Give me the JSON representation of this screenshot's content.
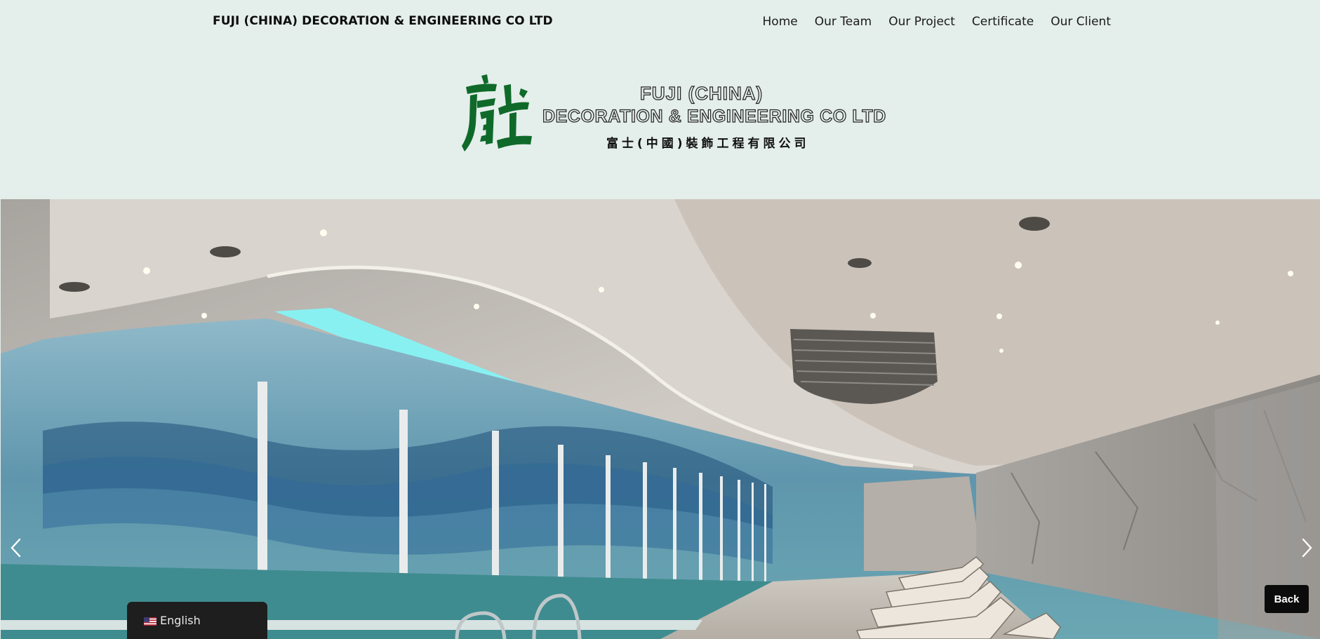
{
  "header": {
    "site_title": "FUJI (CHINA) DECORATION & ENGINEERING CO LTD",
    "nav": [
      "Home",
      "Our Team",
      "Our Project",
      "Certificate",
      "Our Client"
    ]
  },
  "logo": {
    "line1": "FUJI (CHINA)",
    "line2": "DECORATION & ENGINEERING CO LTD",
    "line3": "富士(中國)裝飾工程有限公司",
    "mark_color": "#0f6a2a"
  },
  "slider": {
    "prev_icon": "chevron-left-icon",
    "next_icon": "chevron-right-icon"
  },
  "back_button": {
    "label": "Back"
  },
  "language": {
    "label": "English",
    "flag_icon": "us-flag-icon"
  },
  "colors": {
    "background": "#e4eeea",
    "dark": "#0b0b0b",
    "logo_green": "#0f6a2a"
  }
}
